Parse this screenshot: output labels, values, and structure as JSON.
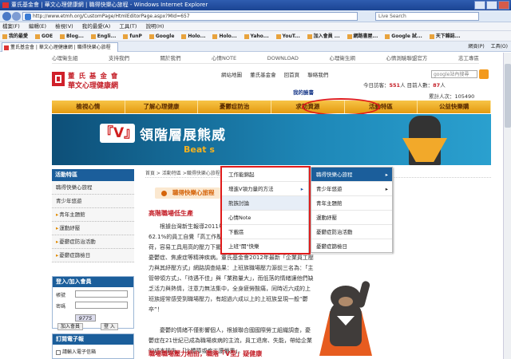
{
  "browser": {
    "title": "董氏基金會 | 華文心理健康網 | 職得快樂心旅程 - Windows Internet Explorer",
    "url": "http://www.etmh.org/CustomPage/HtmlEditorPage.aspx?MId=657",
    "search_placeholder": "Live Search",
    "menu": [
      "檔案(F)",
      "編輯(E)",
      "檢視(V)",
      "我的最愛(A)",
      "工具(T)",
      "說明(H)"
    ],
    "favorites": [
      "我的最愛",
      "GOE",
      "Blog...",
      "Engli...",
      "funP",
      "Google",
      "Holo...",
      "Holo...",
      "Yaho...",
      "YouT...",
      "加入會員 ...",
      "網路書屋...",
      "Google 試...",
      "天下雜誌..."
    ],
    "tab_label": "董氏基金會 | 華文心理健康網 | 職得快樂心旅程",
    "page_tools": [
      "網頁(P)",
      "工具(O)"
    ]
  },
  "site": {
    "top_links": [
      "心理衛生組",
      "支持我們",
      "關於我們",
      "心情NOTE",
      "DOWNLOAD",
      "心理衛生網",
      "心情測驗聯盟官方",
      "志工專區"
    ],
    "logo_line1": "董 氏 基 金 會",
    "logo_line2": "華文心理健康網",
    "header_links": [
      "網站地圖",
      "董氏基金會",
      "回首頁",
      "聯絡我們"
    ],
    "facebook": "我的臉書",
    "google_search_placeholder": "google站內搜尋",
    "stats": {
      "today_label": "今日訪客：",
      "today_value": "551",
      "online_label": "人  目前人數：",
      "online_value": "87",
      "online_unit": "人",
      "total_label": "累計人次：",
      "total_value": "105490"
    },
    "main_nav": [
      "檢視心情",
      "了解心理健康",
      "憂鬱症防治",
      "求助資源",
      "活動特區",
      "公益快樂購"
    ],
    "banner": {
      "v": "『V』",
      "title": "領階層展熊威",
      "subtitle": "Beat s"
    },
    "sidebar": {
      "header": "活動特區",
      "items": [
        "職得快樂心旅程",
        "青少年悠遊",
        "青年主題館",
        "運動紓壓",
        "憂鬱症防治活動",
        "憂鬱症篩檢日"
      ]
    },
    "login": {
      "header": "登入/加入會員",
      "account_label": "帳號",
      "password_label": "密碼",
      "captcha": "9775",
      "join": "加入會員",
      "login": "登 入"
    },
    "epaper": {
      "header": "訂閱電子報",
      "subscribe": "請輸入電子信箱"
    },
    "breadcrumb": "首頁 > 活動特區 >職得快樂心旅程 > ...",
    "page_title": "職得快樂心旅程",
    "heading1": "高階職場低生產",
    "para1": "根據台灣新生報導2011年所發佈的調查指出，在臺灣有62.1%的員工自覺「高工作壓力」；58.4%認為工作要求超過負荷，容易工具用高的壓力下擺不了，可能會對身心造成傷害，造成憂鬱症、焦慮症等精神疾病。董氏基金會2012年最新「企業員工壓力與其紓壓方式」網路調查結果：上班族職場壓力源前三名為：「主管帶領方式」、「待遇不佳」與「業務量大」，而低落的情緒讓他們缺乏活力與熱情，注意力無法集中，全身疲勞酸痛，同時近六成的上班族經常感受到職場壓力，有超過六成以上的上班族呈現一般“鬱卒”！",
    "para2": "憂鬱的情緒不僅影響個人，根據聯合國國際勞工組織調查，憂鬱症在21世紀已成為職場疾病的主流，員工退席、失能，帶給企業的成本損失，「比體障或疾工還嚴重」。",
    "heading2": "職場職場壓力相由，職階「V型」疑健康",
    "dropdown1": [
      "工作能錦起",
      "增進V領力量的方法",
      "熊族討論",
      "心情Note",
      "下載區",
      "上班\"開\"快樂"
    ],
    "dropdown2": [
      "職得快樂心旅程",
      "青少年悠遊",
      "青年主題館",
      "運動紓壓",
      "憂鬱症防治活動",
      "憂鬱症篩檢日"
    ]
  },
  "colors": {
    "brand_red": "#c41e27",
    "nav_orange": "#e49a0f",
    "sidebar_blue": "#1b5e9b",
    "highlight_red": "#e01b1b"
  }
}
